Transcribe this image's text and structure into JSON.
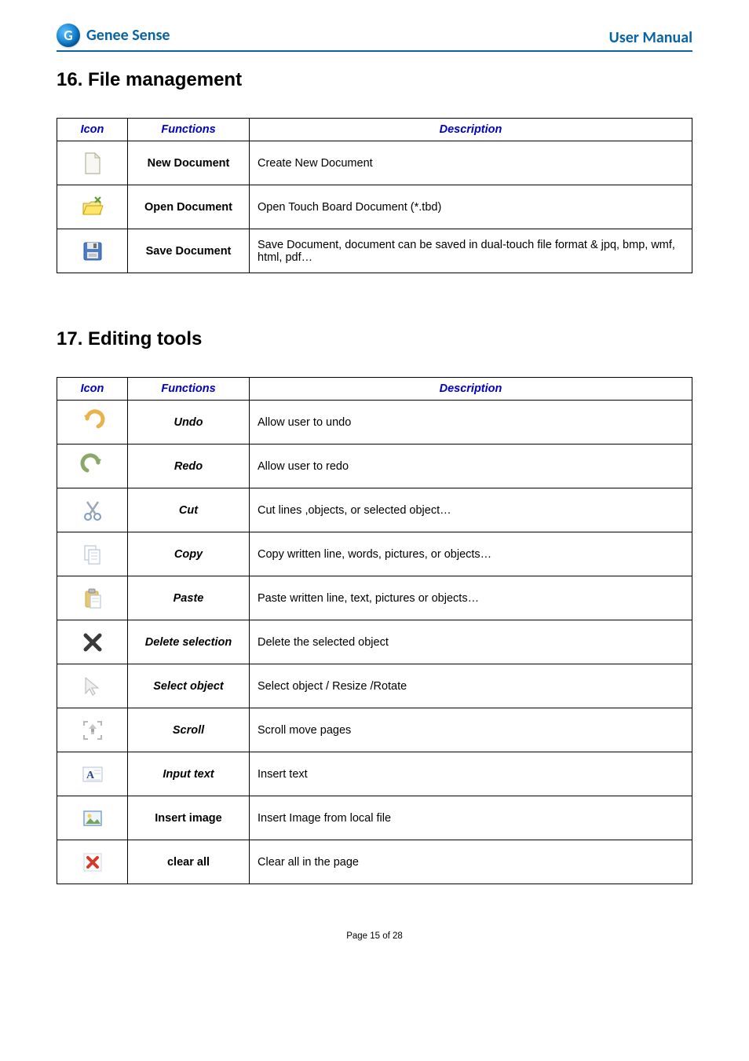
{
  "header": {
    "brand": "Genee Sense",
    "doc_label": "User Manual"
  },
  "section1": {
    "title": "16. File management",
    "columns": [
      "Icon",
      "Functions",
      "Description"
    ],
    "rows": [
      {
        "icon": "new-document-icon",
        "func": "New Document",
        "desc": "Create New Document"
      },
      {
        "icon": "open-document-icon",
        "func": "Open Document",
        "desc": "Open Touch Board Document (*.tbd)"
      },
      {
        "icon": "save-document-icon",
        "func": "Save Document",
        "desc": "Save Document, document can be saved in dual-touch file format & jpq, bmp, wmf, html, pdf…"
      }
    ]
  },
  "section2": {
    "title": "17. Editing tools",
    "columns": [
      "Icon",
      "Functions",
      "Description"
    ],
    "rows": [
      {
        "icon": "undo-icon",
        "func": "Undo",
        "desc": "Allow user to undo",
        "italic": true
      },
      {
        "icon": "redo-icon",
        "func": "Redo",
        "desc": "Allow user to redo",
        "italic": true
      },
      {
        "icon": "cut-icon",
        "func": "Cut",
        "desc": "Cut lines ,objects, or selected object…",
        "italic": true
      },
      {
        "icon": "copy-icon",
        "func": "Copy",
        "desc": "Copy written line, words, pictures, or objects…",
        "italic": true
      },
      {
        "icon": "paste-icon",
        "func": "Paste",
        "desc": "Paste written line, text, pictures or objects…",
        "italic": true
      },
      {
        "icon": "delete-selection-icon",
        "func": "Delete selection",
        "desc": "Delete the selected object",
        "italic": true
      },
      {
        "icon": "select-object-icon",
        "func": "Select object",
        "desc": "Select object / Resize /Rotate",
        "italic": true
      },
      {
        "icon": "scroll-icon",
        "func": "Scroll",
        "desc": "Scroll move pages",
        "italic": true
      },
      {
        "icon": "input-text-icon",
        "func": "Input text",
        "desc": "Insert text",
        "italic": true
      },
      {
        "icon": "insert-image-icon",
        "func": "Insert image",
        "desc": "Insert Image from local file",
        "italic": false
      },
      {
        "icon": "clear-all-icon",
        "func": "clear all",
        "desc": "Clear all in the page",
        "italic": false
      }
    ]
  },
  "footer": {
    "page_label": "Page 15 of 28"
  }
}
